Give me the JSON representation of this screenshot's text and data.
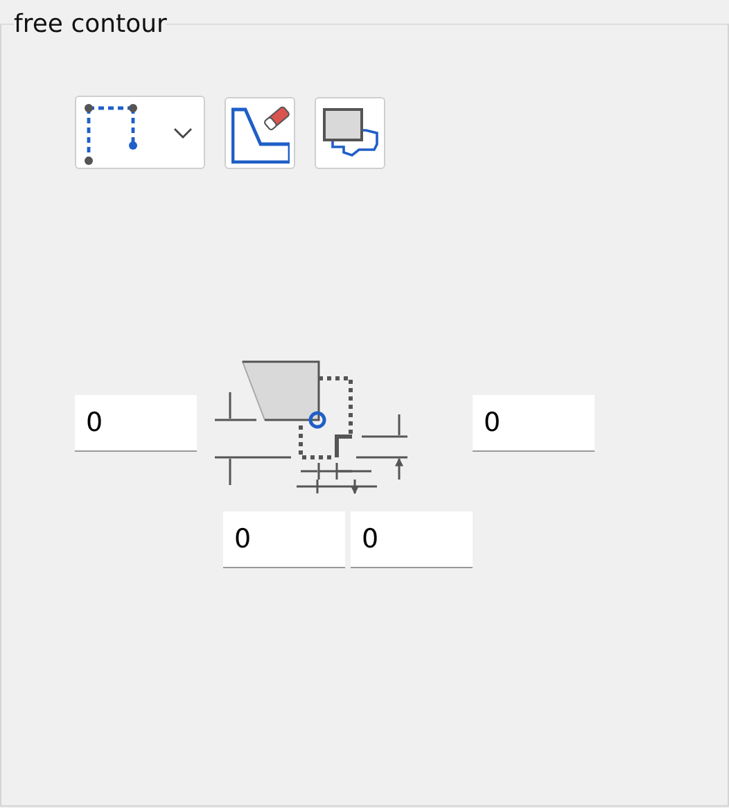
{
  "group": {
    "title": "free contour"
  },
  "toolbar": [
    {
      "kind": "dropdown"
    },
    {
      "kind": "erase"
    },
    {
      "kind": "stock"
    }
  ],
  "fields": [
    {
      "value": "0"
    },
    {
      "value": "0"
    },
    {
      "value": "0"
    },
    {
      "value": "0"
    }
  ]
}
